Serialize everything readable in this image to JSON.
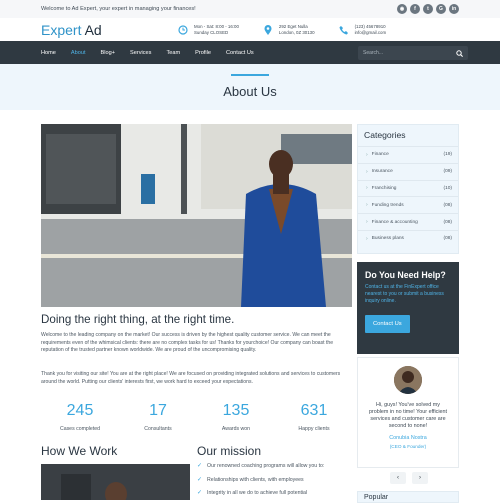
{
  "topbar": {
    "welcome": "Welcome to Ad Expert, your expert in managing your finances!",
    "socials": [
      "rss-icon",
      "facebook-icon",
      "twitter-icon",
      "google-plus-icon",
      "linkedin-icon"
    ]
  },
  "header": {
    "logo_part1": "Expert",
    "logo_part2": " Ad",
    "hours_line1": "Mon - Sat: 8:00 - 16:00",
    "hours_line2": "Sunday CLOSED",
    "address_line1": "292 Eget Nulla",
    "address_line2": "London, 0Z 30130",
    "phone_line1": "(123) 45678910",
    "phone_line2": "info@gmail.com"
  },
  "nav": {
    "items": [
      "Home",
      "About",
      "Blog+",
      "Services",
      "Team",
      "Profile",
      "Contact Us"
    ],
    "active": "About",
    "search_placeholder": "Search..."
  },
  "hero": {
    "title": "About Us"
  },
  "main": {
    "title": "Doing the right thing, at the right time.",
    "para1": "Welcome to the leading company on the market! Our success is driven by the highest quality customer service. We can meet the requirements even of the whimsical clients: there are no complex tasks for us! Thanks for yourchoice! Our company can boast the reputation of the trusted partner known worldwide. We are proud of the uncompromising quality.",
    "para2": "Thank you for visiting our site! You are at the right place! We are focused on providing integrated solutions and services to customers around the world. Putting our clients' interests first, we work hard to exceed your expectations.",
    "stats": [
      {
        "num": "245",
        "label": "Cases completed"
      },
      {
        "num": "17",
        "label": "Consultants"
      },
      {
        "num": "135",
        "label": "Awards won"
      },
      {
        "num": "631",
        "label": "Happy clients"
      }
    ],
    "how_title": "How We Work",
    "mission_title": "Our mission",
    "mission_items": [
      "Our renowned coaching programs will allow you to:",
      "Relationships with clients, with employees",
      "Integrity in all we do to achieve full potential"
    ]
  },
  "sidebar": {
    "categories_title": "Categories",
    "categories": [
      {
        "name": "Finance",
        "count": "(19)"
      },
      {
        "name": "Insurance",
        "count": "(09)"
      },
      {
        "name": "Franchising",
        "count": "(10)"
      },
      {
        "name": "Funding trends",
        "count": "(08)"
      },
      {
        "name": "Finance & accounting",
        "count": "(08)"
      },
      {
        "name": "Business plans",
        "count": "(08)"
      }
    ],
    "help_title": "Do You Need Help?",
    "help_text": "Contact us at the FinExpert office nearest to you or submit a business inquiry online.",
    "help_button": "Contact Us",
    "testimonial_text": "Hi, guys! You've solved my problem in no time! Your efficient services and customer care are second to none!",
    "testimonial_name": "Conubia Nostra",
    "testimonial_role": "(CEO & Founder)",
    "popular_title": "Popular"
  }
}
